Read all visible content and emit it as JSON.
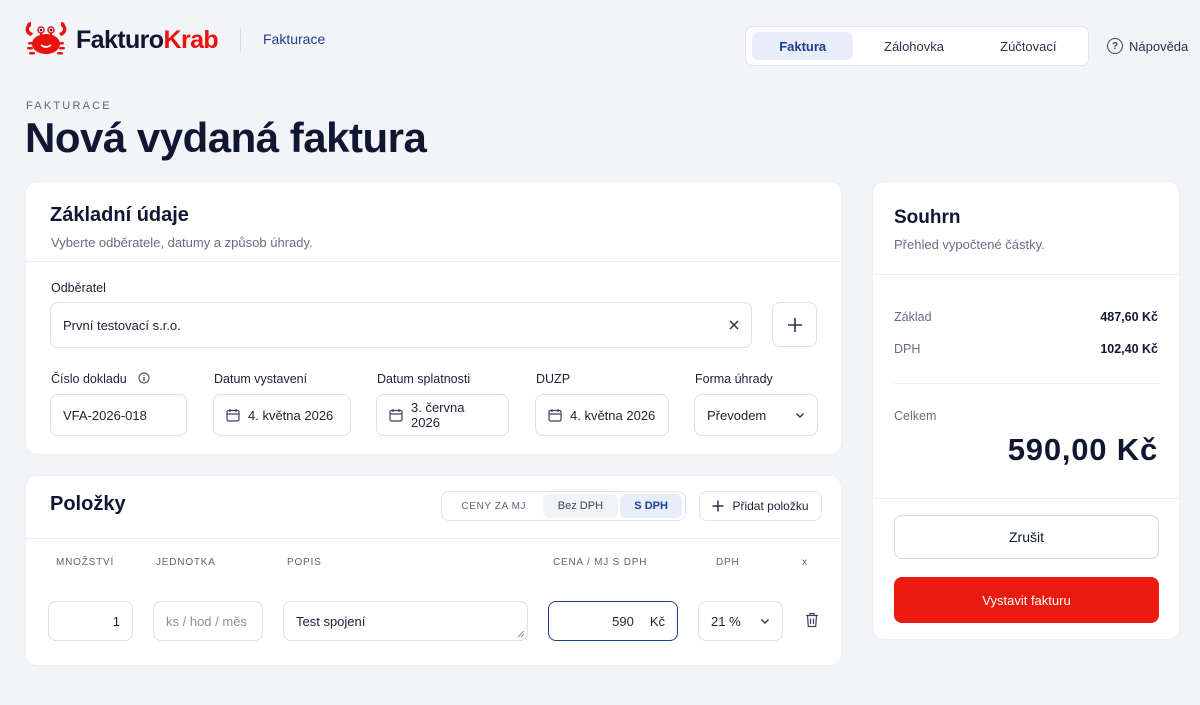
{
  "app": {
    "brand_main": "Fakturo",
    "brand_accent": "Krab",
    "section": "Fakturace",
    "accent_color": "#ea1b0e",
    "brand_color": "#1d3f8f"
  },
  "nav": {
    "tabs": [
      {
        "label": "Faktura",
        "active": true
      },
      {
        "label": "Zálohovka",
        "active": false
      },
      {
        "label": "Zúčtovací",
        "active": false
      }
    ],
    "help_label": "Nápověda"
  },
  "page": {
    "eyebrow": "FAKTURACE",
    "title": "Nová vydaná faktura"
  },
  "basic": {
    "title": "Základní údaje",
    "subtitle": "Vyberte odběratele, datumy a způsob úhrady.",
    "customer_label": "Odběratel",
    "customer_value": "První testovací s.r.o.",
    "doc_number_label": "Číslo dokladu",
    "doc_number_value": "VFA-2026-018",
    "issue_date_label": "Datum vystavení",
    "issue_date_value": "4. května 2026",
    "due_date_label": "Datum splatnosti",
    "due_date_value": "3. června 2026",
    "duzp_label": "DUZP",
    "duzp_value": "4. května 2026",
    "payment_label": "Forma úhrady",
    "payment_value": "Převodem"
  },
  "items": {
    "title": "Položky",
    "price_toggle_label": "CENY ZA MJ",
    "price_options": [
      {
        "label": "Bez DPH",
        "active": false
      },
      {
        "label": "S DPH",
        "active": true
      }
    ],
    "add_label": "Přidat položku",
    "columns": {
      "qty": "MNOŽSTVÍ",
      "unit": "JEDNOTKA",
      "desc": "POPIS",
      "price": "CENA / MJ S DPH",
      "vat": "DPH",
      "remove": "x"
    },
    "rows": [
      {
        "qty": "1",
        "unit_placeholder": "ks / hod / měs",
        "unit": "",
        "desc": "Test spojení",
        "price": "590",
        "currency": "Kč",
        "vat": "21 %"
      }
    ]
  },
  "summary": {
    "title": "Souhrn",
    "subtitle": "Přehled vypočtené částky.",
    "base_label": "Základ",
    "base_value": "487,60 Kč",
    "vat_label": "DPH",
    "vat_value": "102,40 Kč",
    "total_label": "Celkem",
    "total_value": "590,00 Kč",
    "cancel_label": "Zrušit",
    "issue_label": "Vystavit fakturu"
  }
}
